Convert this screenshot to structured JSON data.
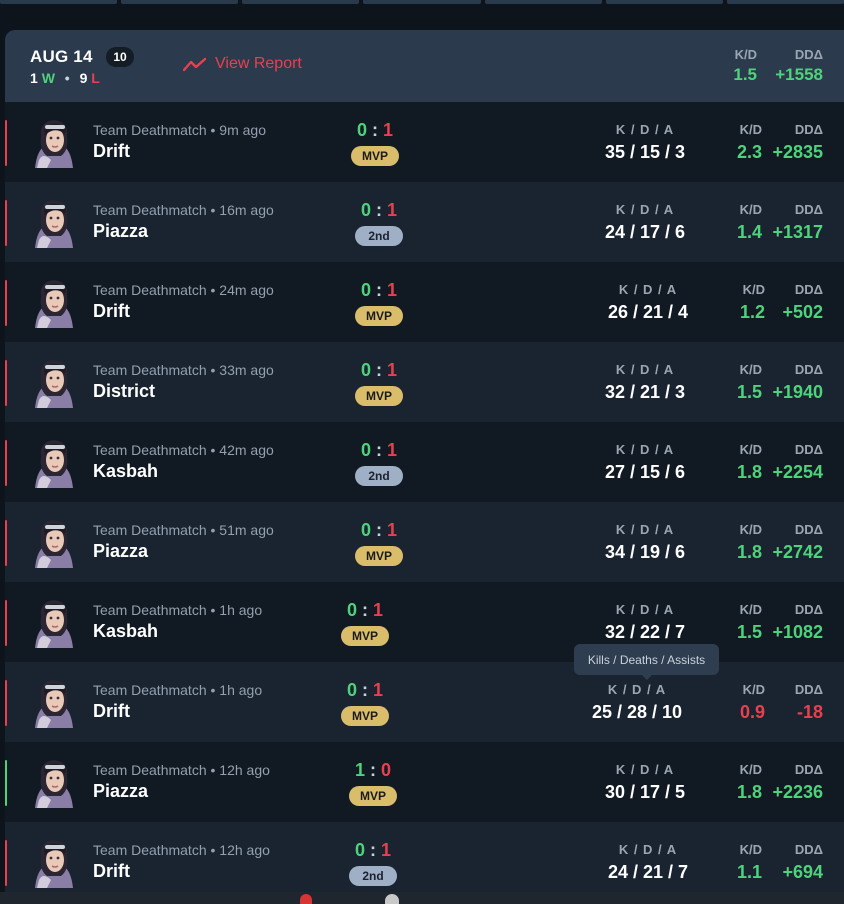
{
  "header": {
    "date": "AUG 14",
    "count": "10",
    "wins": "1",
    "wins_suffix": "W",
    "losses": "9",
    "losses_suffix": "L",
    "view_report": "View Report",
    "kd_label": "K/D",
    "kd_value": "1.5",
    "dd_label": "DDΔ",
    "dd_value": "+1558"
  },
  "labels": {
    "kda": "K / D / A",
    "kd": "K/D",
    "dd": "DDΔ"
  },
  "tooltip": "Kills / Deaths / Assists",
  "matches": [
    {
      "mode": "Team Deathmatch • 9m ago",
      "map": "Drift",
      "score_a": "0",
      "score_b": "1",
      "badge": "MVP",
      "kda": "35 / 15 / 3",
      "kd": "2.3",
      "dd": "+2835",
      "result": "loss"
    },
    {
      "mode": "Team Deathmatch • 16m ago",
      "map": "Piazza",
      "score_a": "0",
      "score_b": "1",
      "badge": "2nd",
      "kda": "24 / 17 / 6",
      "kd": "1.4",
      "dd": "+1317",
      "result": "loss"
    },
    {
      "mode": "Team Deathmatch • 24m ago",
      "map": "Drift",
      "score_a": "0",
      "score_b": "1",
      "badge": "MVP",
      "kda": "26 / 21 / 4",
      "kd": "1.2",
      "dd": "+502",
      "result": "loss"
    },
    {
      "mode": "Team Deathmatch • 33m ago",
      "map": "District",
      "score_a": "0",
      "score_b": "1",
      "badge": "MVP",
      "kda": "32 / 21 / 3",
      "kd": "1.5",
      "dd": "+1940",
      "result": "loss"
    },
    {
      "mode": "Team Deathmatch • 42m ago",
      "map": "Kasbah",
      "score_a": "0",
      "score_b": "1",
      "badge": "2nd",
      "kda": "27 / 15 / 6",
      "kd": "1.8",
      "dd": "+2254",
      "result": "loss"
    },
    {
      "mode": "Team Deathmatch • 51m ago",
      "map": "Piazza",
      "score_a": "0",
      "score_b": "1",
      "badge": "MVP",
      "kda": "34 / 19 / 6",
      "kd": "1.8",
      "dd": "+2742",
      "result": "loss"
    },
    {
      "mode": "Team Deathmatch • 1h ago",
      "map": "Kasbah",
      "score_a": "0",
      "score_b": "1",
      "badge": "MVP",
      "kda": "32 / 22 / 7",
      "kd": "1.5",
      "dd": "+1082",
      "result": "loss"
    },
    {
      "mode": "Team Deathmatch • 1h ago",
      "map": "Drift",
      "score_a": "0",
      "score_b": "1",
      "badge": "MVP",
      "kda": "25 / 28 / 10",
      "kd": "0.9",
      "dd": "-18",
      "result": "loss"
    },
    {
      "mode": "Team Deathmatch • 12h ago",
      "map": "Piazza",
      "score_a": "1",
      "score_b": "0",
      "badge": "MVP",
      "kda": "30 / 17 / 5",
      "kd": "1.8",
      "dd": "+2236",
      "result": "win"
    },
    {
      "mode": "Team Deathmatch • 12h ago",
      "map": "Drift",
      "score_a": "0",
      "score_b": "1",
      "badge": "2nd",
      "kda": "24 / 21 / 7",
      "kd": "1.1",
      "dd": "+694",
      "result": "loss"
    }
  ]
}
